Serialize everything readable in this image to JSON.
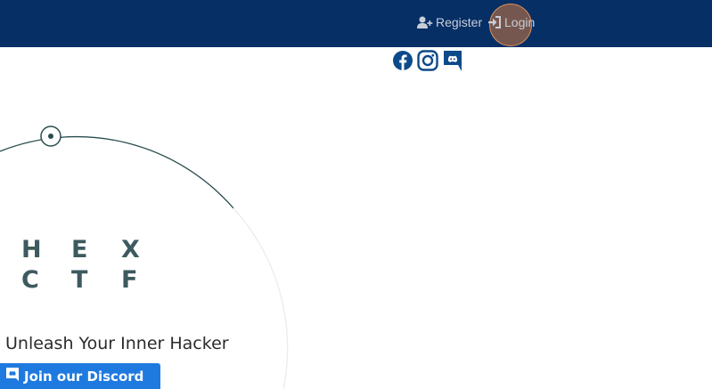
{
  "nav": {
    "register_label": "Register",
    "login_label": "Login",
    "register_icon": "user-plus-icon",
    "login_icon": "sign-in-icon"
  },
  "socials": [
    {
      "icon": "facebook-icon"
    },
    {
      "icon": "instagram-icon"
    },
    {
      "icon": "discord-icon"
    }
  ],
  "hero": {
    "logo_row1": [
      "H",
      "E",
      "X"
    ],
    "logo_row2": [
      "C",
      "T",
      "F"
    ],
    "tagline": "Unleash Your Inner Hacker",
    "discord_button_label": "Join our Discord"
  },
  "colors": {
    "navbar": "#062f66",
    "logo": "#3d5a5e",
    "button": "#1f7ae0",
    "social_icons": "#0d4a8a"
  }
}
